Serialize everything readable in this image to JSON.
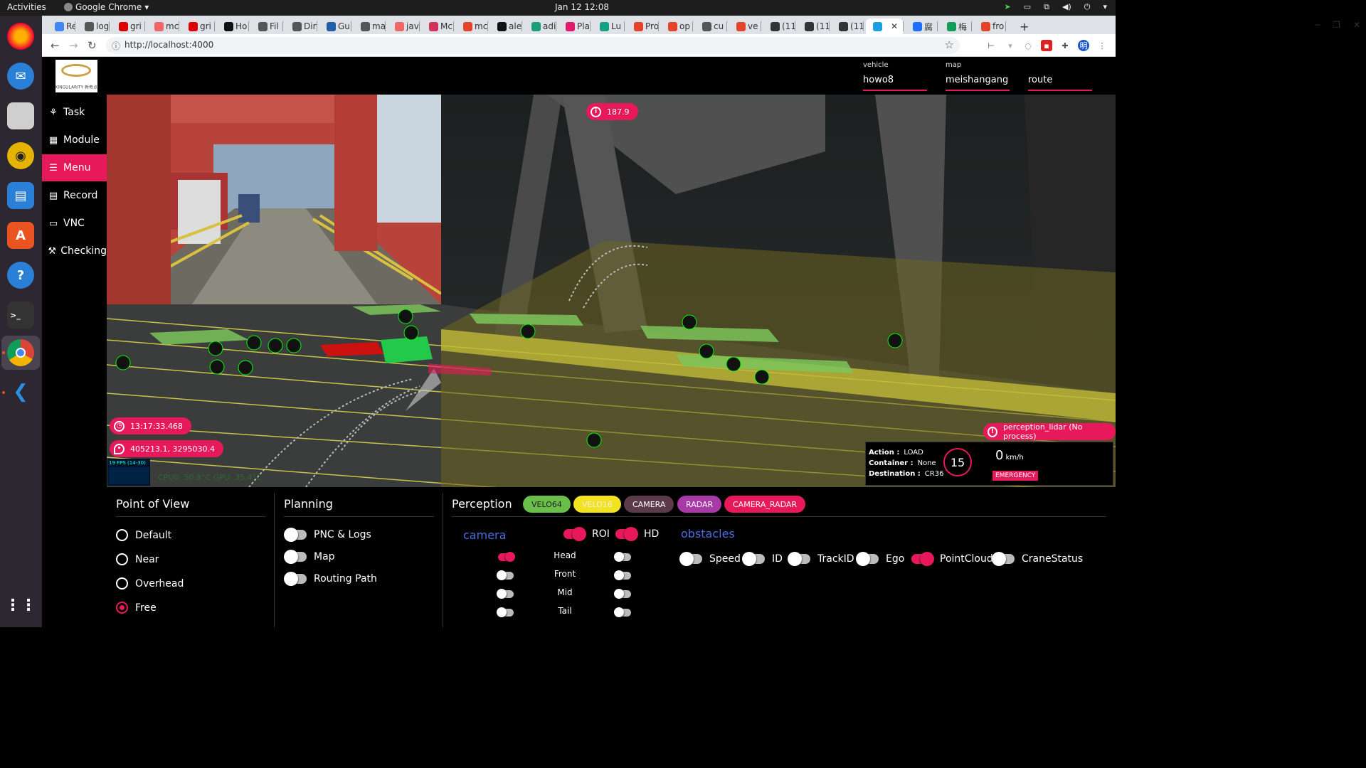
{
  "topbar": {
    "activities": "Activities",
    "app_name": "Google Chrome",
    "clock": "Jan 12  12:08"
  },
  "dock": {
    "items": [
      "firefox",
      "thunderbird",
      "files",
      "rhythmbox",
      "libreoffice-writer",
      "software-center",
      "help",
      "terminal",
      "chrome",
      "vscode",
      "show-apps"
    ]
  },
  "browser": {
    "tabs": [
      {
        "label": "Re",
        "color": "#4285f4"
      },
      {
        "label": "log",
        "color": "#555"
      },
      {
        "label": "gri",
        "color": "#d00"
      },
      {
        "label": "mc",
        "color": "#e66"
      },
      {
        "label": "gri",
        "color": "#d00"
      },
      {
        "label": "Ho",
        "color": "#111"
      },
      {
        "label": "Fil",
        "color": "#555"
      },
      {
        "label": "Dir",
        "color": "#555"
      },
      {
        "label": "Gu",
        "color": "#1f5fa8"
      },
      {
        "label": "ma",
        "color": "#555"
      },
      {
        "label": "jav",
        "color": "#e66"
      },
      {
        "label": "Mc",
        "color": "#d0345a"
      },
      {
        "label": "mc",
        "color": "#e24329"
      },
      {
        "label": "ale",
        "color": "#111"
      },
      {
        "label": "adi",
        "color": "#1b9e77"
      },
      {
        "label": "Pla",
        "color": "#e0196c"
      },
      {
        "label": "Lu",
        "color": "#16a085"
      },
      {
        "label": "Pro",
        "color": "#e24329"
      },
      {
        "label": "op",
        "color": "#e24329"
      },
      {
        "label": "cu",
        "color": "#555"
      },
      {
        "label": "ve",
        "color": "#e24329"
      },
      {
        "label": "(11",
        "color": "#333"
      },
      {
        "label": "(11",
        "color": "#333"
      },
      {
        "label": "(11",
        "color": "#333"
      },
      {
        "label": "",
        "color": "#1aa1e5",
        "active": true
      },
      {
        "label": "腐",
        "color": "#1e6fff"
      },
      {
        "label": "梅",
        "color": "#0f9d58"
      },
      {
        "label": "fro",
        "color": "#e24329"
      }
    ],
    "new_tab": "+",
    "url": "http://localhost:4000",
    "profile_initial": "明"
  },
  "app": {
    "logo_text": "XINGULARITY 新奇点",
    "nav": [
      {
        "label": "Task",
        "icon": "task-icon",
        "glyph": "⚘"
      },
      {
        "label": "Module",
        "icon": "grid-icon",
        "glyph": "▦"
      },
      {
        "label": "Menu",
        "icon": "hamburger-icon",
        "glyph": "☰",
        "active": true
      },
      {
        "label": "Record",
        "icon": "list-icon",
        "glyph": "▤"
      },
      {
        "label": "VNC",
        "icon": "monitor-icon",
        "glyph": "▭"
      },
      {
        "label": "Checking",
        "icon": "wrench-icon",
        "glyph": "⚒"
      }
    ],
    "selectors": [
      {
        "label": "vehicle",
        "value": "howo8"
      },
      {
        "label": "map",
        "value": "meishangang"
      },
      {
        "label": "",
        "value": "route"
      }
    ]
  },
  "viewport": {
    "info_badge": "187.9",
    "time_badge": "13:17:33.468",
    "position_badge": "405213.1, 3295030.4",
    "alert_badge": "perception_lidar (No process)",
    "fps_text": "19 FPS (14-30)",
    "cpu_text": "CPU0: 50.8°C    GPU: 35.4°C",
    "status": {
      "action_label": "Action :",
      "action": "LOAD",
      "container_label": "Container :",
      "container": "None",
      "destination_label": "Destination :",
      "destination": "CR36",
      "gear": "15",
      "speed": "0",
      "speed_unit": "km/h",
      "emergency": "EMERGENCY"
    }
  },
  "panel": {
    "point_of_view": {
      "title": "Point of View",
      "options": [
        "Default",
        "Near",
        "Overhead",
        "Free"
      ],
      "selected": "Free"
    },
    "planning": {
      "title": "Planning",
      "toggles": [
        {
          "label": "PNC & Logs",
          "on": false
        },
        {
          "label": "Map",
          "on": false
        },
        {
          "label": "Routing Path",
          "on": false
        }
      ]
    },
    "perception": {
      "title": "Perception",
      "chips": [
        {
          "label": "VELO64",
          "bg": "#6abf4b",
          "fg": "#222"
        },
        {
          "label": "VELO16",
          "bg": "#f2e21f",
          "fg": "#eee"
        },
        {
          "label": "CAMERA",
          "bg": "#5b3a4a",
          "fg": "#fff"
        },
        {
          "label": "RADAR",
          "bg": "#a83aa8",
          "fg": "#fff"
        },
        {
          "label": "CAMERA_RADAR",
          "bg": "#e8195b",
          "fg": "#fff"
        }
      ],
      "camera_title": "camera",
      "roi_label": "ROI",
      "roi_on": true,
      "hd_label": "HD",
      "hd_on": true,
      "camera_rows": [
        {
          "label": "Head",
          "left": true,
          "right": false
        },
        {
          "label": "Front",
          "left": false,
          "right": false
        },
        {
          "label": "Mid",
          "left": false,
          "right": false
        },
        {
          "label": "Tail",
          "left": false,
          "right": false
        }
      ],
      "obstacles_title": "obstacles",
      "obstacle_toggles": [
        {
          "label": "Speed",
          "on": false
        },
        {
          "label": "ID",
          "on": false
        },
        {
          "label": "TrackID",
          "on": false
        },
        {
          "label": "Ego",
          "on": false
        },
        {
          "label": "PointCloud",
          "on": true
        },
        {
          "label": "CraneStatus",
          "on": false
        }
      ]
    }
  },
  "colors": {
    "accent": "#e8195b",
    "dock_bg": "#2c2730",
    "topbar_bg": "#1d1d1d",
    "camera_link": "#4a6ee0"
  }
}
